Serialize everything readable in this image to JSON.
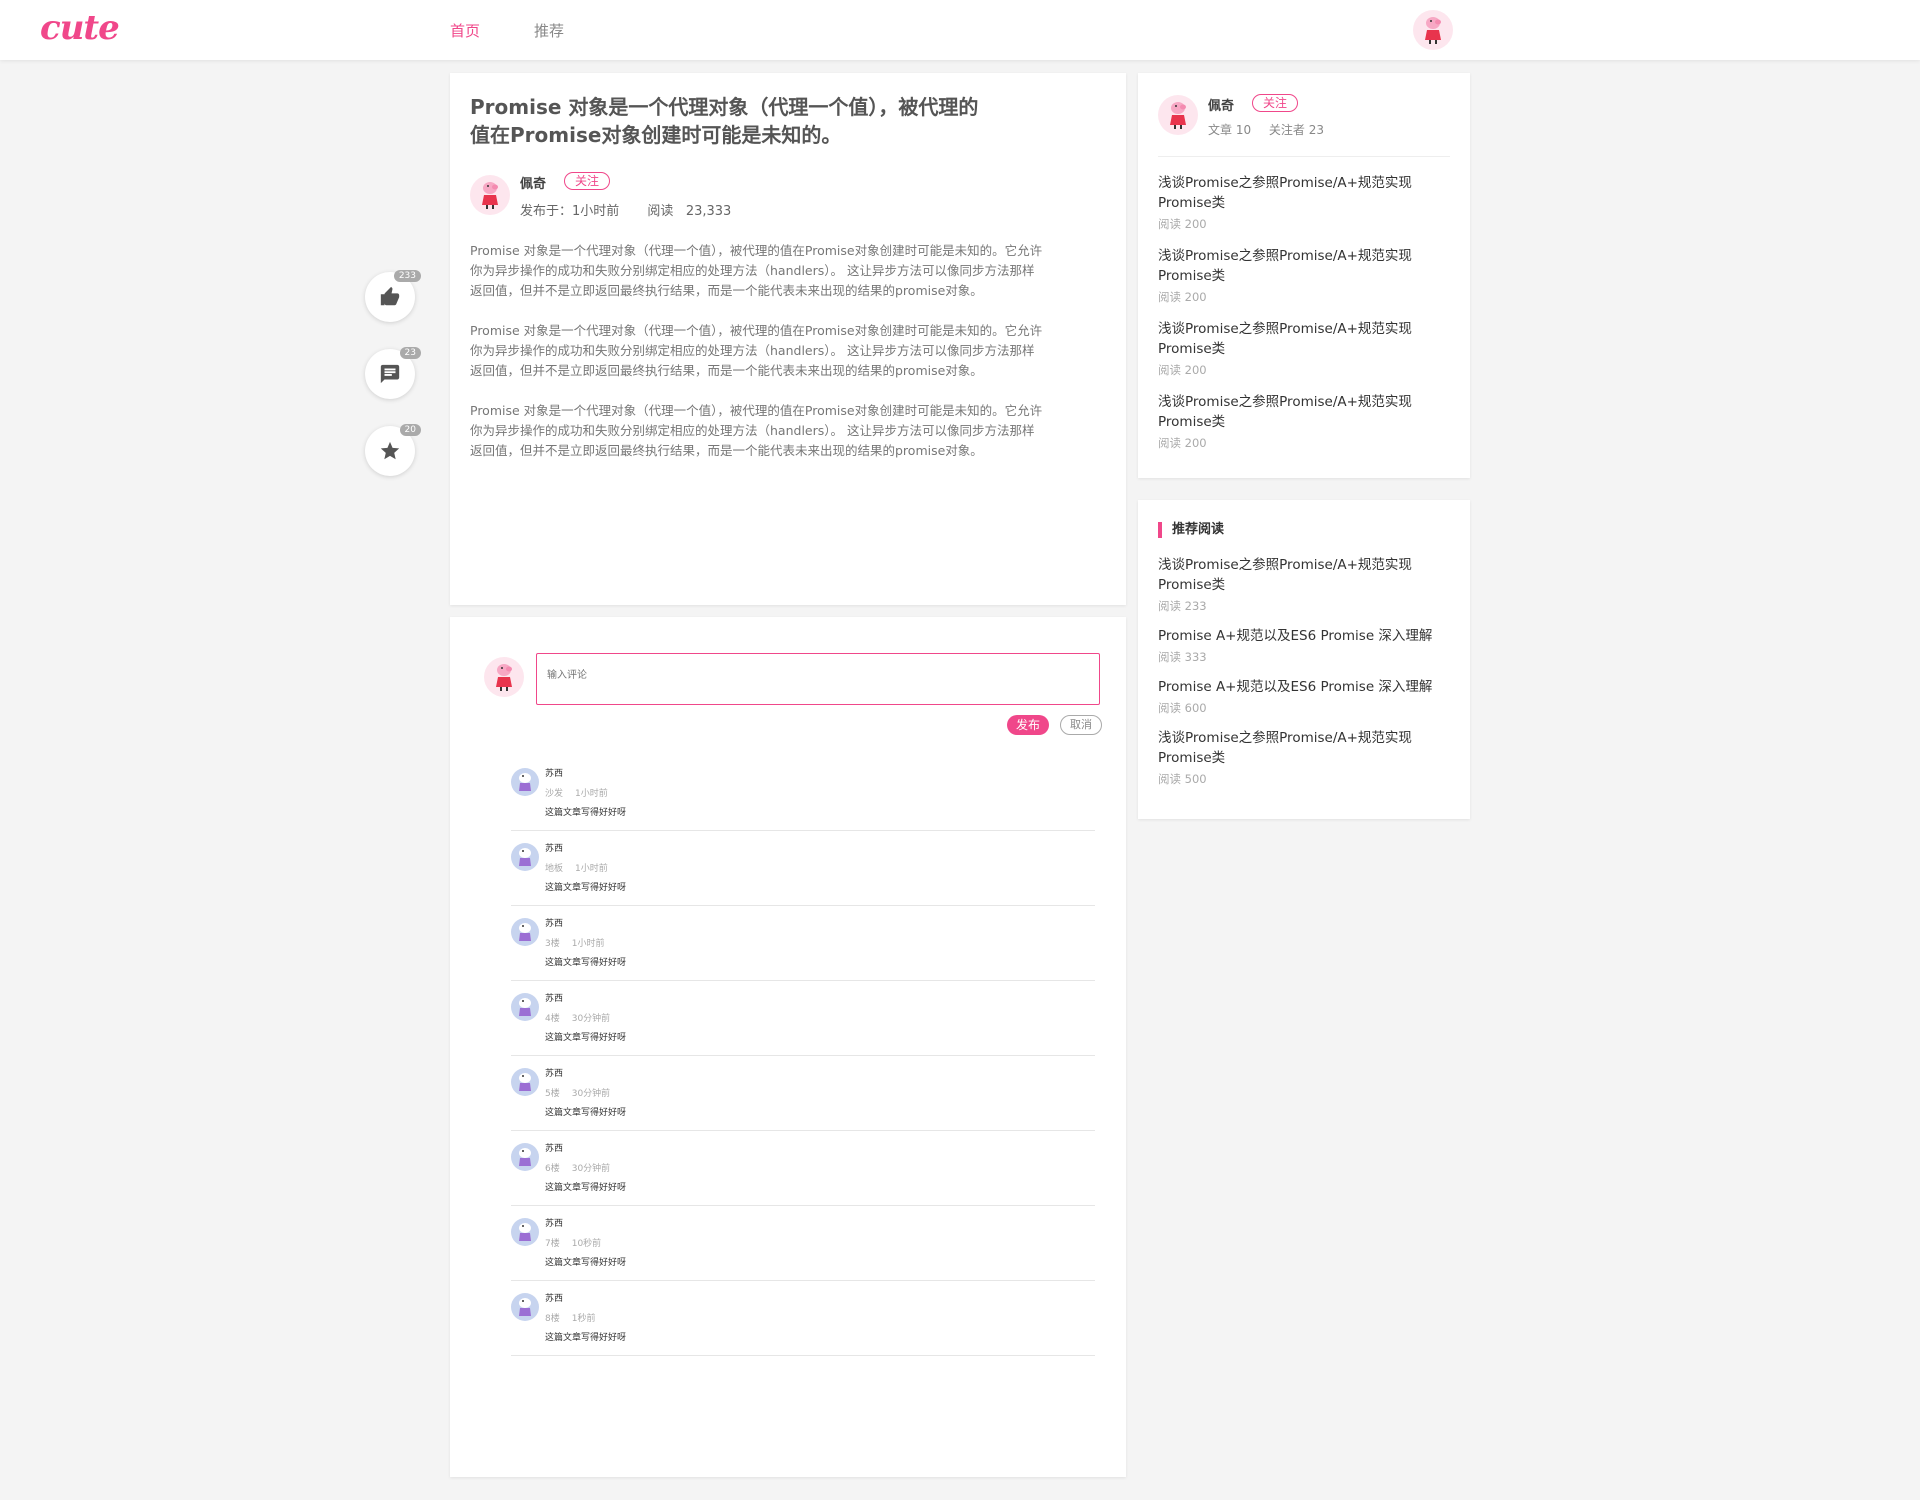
{
  "header": {
    "logo": "cute",
    "nav": [
      "首页",
      "推荐"
    ]
  },
  "article": {
    "title": "Promise 对象是一个代理对象（代理一个值），被代理的值在Promise对象创建时可能是未知的。",
    "author": "佩奇",
    "follow_label": "关注",
    "published": "发布于：1小时前",
    "reads": "阅读   23,333",
    "paragraphs": [
      "Promise 对象是一个代理对象（代理一个值），被代理的值在Promise对象创建时可能是未知的。它允许你为异步操作的成功和失败分别绑定相应的处理方法（handlers）。 这让异步方法可以像同步方法那样返回值，但并不是立即返回最终执行结果，而是一个能代表未来出现的结果的promise对象。",
      "Promise 对象是一个代理对象（代理一个值），被代理的值在Promise对象创建时可能是未知的。它允许你为异步操作的成功和失败分别绑定相应的处理方法（handlers）。 这让异步方法可以像同步方法那样返回值，但并不是立即返回最终执行结果，而是一个能代表未来出现的结果的promise对象。",
      "Promise 对象是一个代理对象（代理一个值），被代理的值在Promise对象创建时可能是未知的。它允许你为异步操作的成功和失败分别绑定相应的处理方法（handlers）。 这让异步方法可以像同步方法那样返回值，但并不是立即返回最终执行结果，而是一个能代表未来出现的结果的promise对象。"
    ]
  },
  "float_actions": {
    "like_count": "233",
    "comment_count": "23",
    "star_count": "20"
  },
  "comment_box": {
    "placeholder": "输入评论",
    "publish_label": "发布",
    "cancel_label": "取消"
  },
  "comments": [
    {
      "name": "苏西",
      "floor": "沙发",
      "time": "1小时前",
      "text": "这篇文章写得好好呀"
    },
    {
      "name": "苏西",
      "floor": "地板",
      "time": "1小时前",
      "text": "这篇文章写得好好呀"
    },
    {
      "name": "苏西",
      "floor": "3楼",
      "time": "1小时前",
      "text": "这篇文章写得好好呀"
    },
    {
      "name": "苏西",
      "floor": "4楼",
      "time": "30分钟前",
      "text": "这篇文章写得好好呀"
    },
    {
      "name": "苏西",
      "floor": "5楼",
      "time": "30分钟前",
      "text": "这篇文章写得好好呀"
    },
    {
      "name": "苏西",
      "floor": "6楼",
      "time": "30分钟前",
      "text": "这篇文章写得好好呀"
    },
    {
      "name": "苏西",
      "floor": "7楼",
      "time": "10秒前",
      "text": "这篇文章写得好好呀"
    },
    {
      "name": "苏西",
      "floor": "8楼",
      "time": "1秒前",
      "text": "这篇文章写得好好呀"
    }
  ],
  "side_author": {
    "name": "佩奇",
    "follow_label": "关注",
    "articles": "文章 10",
    "followers": "关注者 23",
    "posts": [
      {
        "title": "浅谈Promise之参照Promise/A+规范实现Promise类",
        "reads": "阅读 200"
      },
      {
        "title": "浅谈Promise之参照Promise/A+规范实现Promise类",
        "reads": "阅读 200"
      },
      {
        "title": "浅谈Promise之参照Promise/A+规范实现Promise类",
        "reads": "阅读 200"
      },
      {
        "title": "浅谈Promise之参照Promise/A+规范实现Promise类",
        "reads": "阅读 200"
      }
    ]
  },
  "recommend": {
    "heading": "推荐阅读",
    "posts": [
      {
        "title": "浅谈Promise之参照Promise/A+规范实现Promise类",
        "reads": "阅读 233"
      },
      {
        "title": "Promise A+规范以及ES6 Promise 深入理解",
        "reads": "阅读 333"
      },
      {
        "title": "Promise A+规范以及ES6 Promise 深入理解",
        "reads": "阅读 600"
      },
      {
        "title": "浅谈Promise之参照Promise/A+规范实现Promise类",
        "reads": "阅读 500"
      }
    ]
  },
  "colors": {
    "accent": "#f0478a",
    "background": "#f4f4f4"
  },
  "icons": [
    "thumbs-up-icon",
    "comment-icon",
    "star-icon",
    "peppa-avatar-icon",
    "suzy-avatar-icon"
  ]
}
